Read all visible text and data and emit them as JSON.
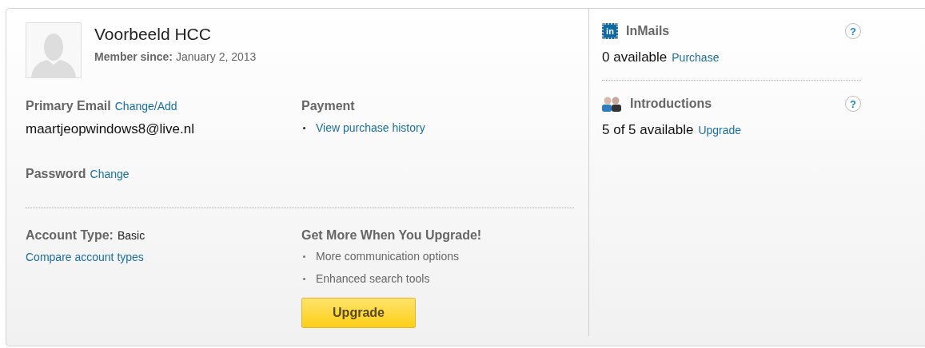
{
  "profile": {
    "name": "Voorbeeld HCC",
    "member_since_label": "Member since:",
    "member_since": "January 2, 2013"
  },
  "email": {
    "label": "Primary Email",
    "action": "Change/Add",
    "value": "maartjeopwindows8@live.nl"
  },
  "password": {
    "label": "Password",
    "action": "Change"
  },
  "payment": {
    "title": "Payment",
    "links": [
      "View purchase history"
    ]
  },
  "account": {
    "label": "Account Type:",
    "value": "Basic",
    "link": "Compare account types"
  },
  "upgrade": {
    "title": "Get More When You Upgrade!",
    "benefits": [
      "More communication options",
      "Enhanced search tools"
    ],
    "button": "Upgrade"
  },
  "features": [
    {
      "kind": "inmail",
      "badge": "in",
      "title": "InMails",
      "help": "?",
      "status": "0 available",
      "action": "Purchase"
    },
    {
      "kind": "introductions",
      "title": "Introductions",
      "help": "?",
      "status": "5 of 5 available",
      "action": "Upgrade"
    }
  ]
}
